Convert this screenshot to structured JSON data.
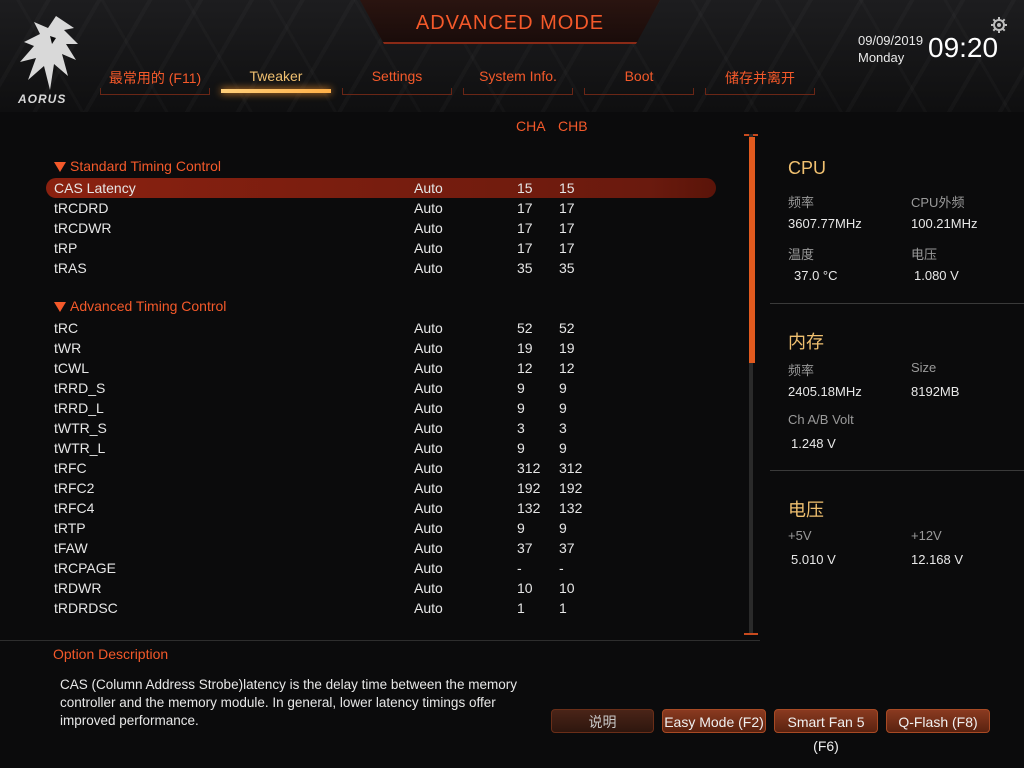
{
  "header": {
    "mode_title": "ADVANCED MODE",
    "brand": "AORUS",
    "date": "09/09/2019",
    "day": "Monday",
    "time": "09:20"
  },
  "tabs": [
    {
      "label": "最常用的 (F11)",
      "active": false
    },
    {
      "label": "Tweaker",
      "active": true
    },
    {
      "label": "Settings",
      "active": false
    },
    {
      "label": "System Info.",
      "active": false
    },
    {
      "label": "Boot",
      "active": false
    },
    {
      "label": "储存并离开",
      "active": false
    }
  ],
  "columns": {
    "cha": "CHA",
    "chb": "CHB"
  },
  "groups": {
    "standard": "Standard Timing Control",
    "advanced": "Advanced Timing Control"
  },
  "standard_rows": [
    {
      "name": "CAS Latency",
      "value": "Auto",
      "cha": "15",
      "chb": "15",
      "selected": true
    },
    {
      "name": "tRCDRD",
      "value": "Auto",
      "cha": "17",
      "chb": "17"
    },
    {
      "name": "tRCDWR",
      "value": "Auto",
      "cha": "17",
      "chb": "17"
    },
    {
      "name": "tRP",
      "value": "Auto",
      "cha": "17",
      "chb": "17"
    },
    {
      "name": "tRAS",
      "value": "Auto",
      "cha": "35",
      "chb": "35"
    }
  ],
  "advanced_rows": [
    {
      "name": "tRC",
      "value": "Auto",
      "cha": "52",
      "chb": "52"
    },
    {
      "name": "tWR",
      "value": "Auto",
      "cha": "19",
      "chb": "19"
    },
    {
      "name": "tCWL",
      "value": "Auto",
      "cha": "12",
      "chb": "12"
    },
    {
      "name": "tRRD_S",
      "value": "Auto",
      "cha": "9",
      "chb": "9"
    },
    {
      "name": "tRRD_L",
      "value": "Auto",
      "cha": "9",
      "chb": "9"
    },
    {
      "name": "tWTR_S",
      "value": "Auto",
      "cha": "3",
      "chb": "3"
    },
    {
      "name": "tWTR_L",
      "value": "Auto",
      "cha": "9",
      "chb": "9"
    },
    {
      "name": "tRFC",
      "value": "Auto",
      "cha": "312",
      "chb": "312"
    },
    {
      "name": "tRFC2",
      "value": "Auto",
      "cha": "192",
      "chb": "192"
    },
    {
      "name": "tRFC4",
      "value": "Auto",
      "cha": "132",
      "chb": "132"
    },
    {
      "name": "tRTP",
      "value": "Auto",
      "cha": "9",
      "chb": "9"
    },
    {
      "name": "tFAW",
      "value": "Auto",
      "cha": "37",
      "chb": "37"
    },
    {
      "name": "tRCPAGE",
      "value": "Auto",
      "cha": "-",
      "chb": "-"
    },
    {
      "name": "tRDWR",
      "value": "Auto",
      "cha": "10",
      "chb": "10"
    },
    {
      "name": "tRDRDSC",
      "value": "Auto",
      "cha": "1",
      "chb": "1"
    }
  ],
  "side": {
    "cpu": {
      "title": "CPU",
      "freq_label": "频率",
      "freq": "3607.77MHz",
      "bclk_label": "CPU外频",
      "bclk": "100.21MHz",
      "temp_label": "温度",
      "temp": "37.0 °C",
      "volt_label": "电压",
      "volt": "1.080 V"
    },
    "memory": {
      "title": "内存",
      "freq_label": "频率",
      "freq": "2405.18MHz",
      "size_label": "Size",
      "size": "8192MB",
      "volt_label": "Ch A/B Volt",
      "volt": "1.248 V"
    },
    "voltage": {
      "title": "电压",
      "v5_label": "+5V",
      "v5": "5.010 V",
      "v12_label": "+12V",
      "v12": "12.168 V"
    }
  },
  "description": {
    "title": "Option Description",
    "text": "CAS (Column Address Strobe)latency is the delay time between the memory controller and the memory module. In general, lower latency timings offer improved performance."
  },
  "buttons": {
    "help": "说明",
    "easy_mode": "Easy Mode (F2)",
    "smart_fan": "Smart Fan 5 (F6)",
    "qflash": "Q-Flash (F8)"
  },
  "colors": {
    "accent": "#f4592a",
    "highlight": "#f0c070",
    "selected_row": "#8a2110"
  }
}
